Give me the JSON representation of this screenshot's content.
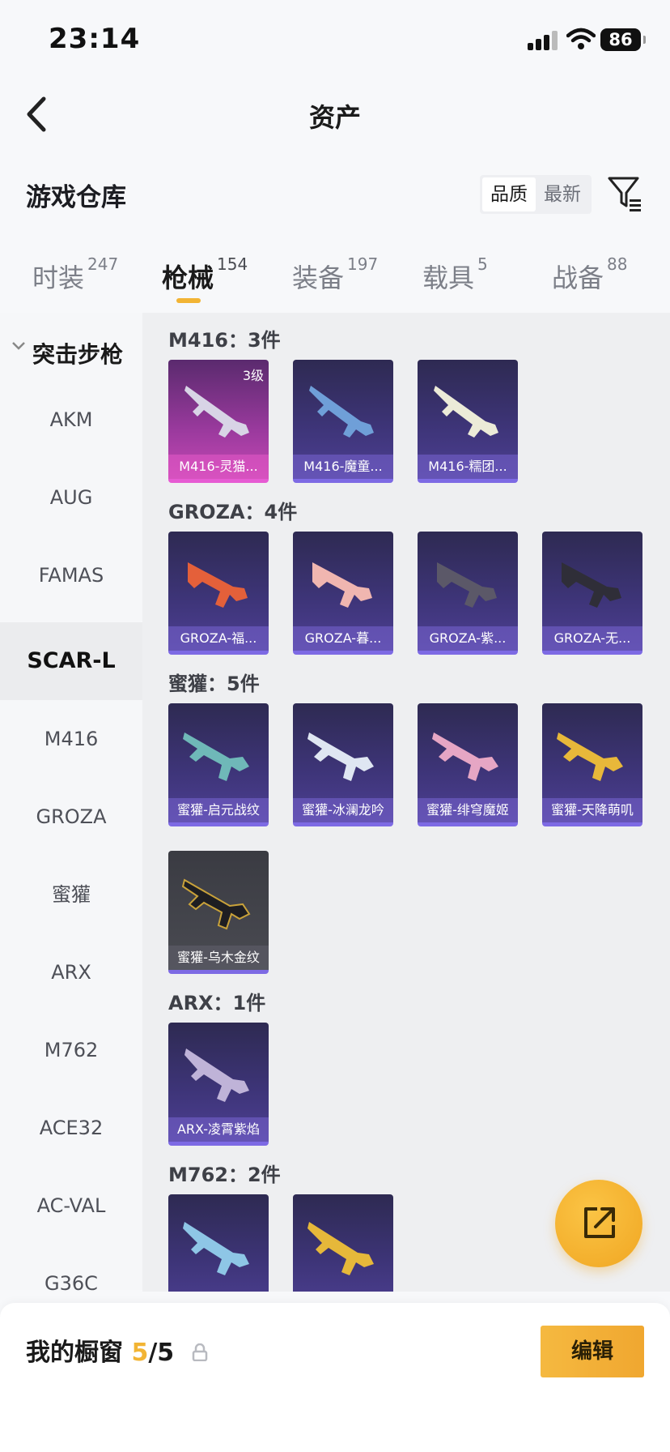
{
  "status_bar": {
    "time": "23:14",
    "battery": "86"
  },
  "nav": {
    "title": "资产"
  },
  "warehouse": {
    "title": "游戏仓库",
    "sort_options": [
      "品质",
      "最新"
    ]
  },
  "tabs": [
    {
      "label": "时装",
      "count": "247"
    },
    {
      "label": "枪械",
      "count": "154"
    },
    {
      "label": "装备",
      "count": "197"
    },
    {
      "label": "载具",
      "count": "5"
    },
    {
      "label": "战备",
      "count": "88"
    }
  ],
  "sidebar": {
    "group": "突击步枪",
    "items": [
      "AKM",
      "AUG",
      "FAMAS",
      "SCAR-L",
      "M416",
      "GROZA",
      "蜜獾",
      "ARX",
      "M762",
      "ACE32",
      "AC-VAL",
      "G36C"
    ],
    "selected": "SCAR-L"
  },
  "sections": [
    {
      "title": "M416：3件",
      "items": [
        {
          "name": "M416-灵猫...",
          "level": "3级"
        },
        {
          "name": "M416-魔童..."
        },
        {
          "name": "M416-糯团..."
        }
      ]
    },
    {
      "title": "GROZA：4件",
      "items": [
        {
          "name": "GROZA-福..."
        },
        {
          "name": "GROZA-暮..."
        },
        {
          "name": "GROZA-紫..."
        },
        {
          "name": "GROZA-无..."
        }
      ]
    },
    {
      "title": "蜜獾：5件",
      "items": [
        {
          "name": "蜜獾-启元战纹"
        },
        {
          "name": "蜜獾-冰澜龙吟"
        },
        {
          "name": "蜜獾-绯穹魔姬"
        },
        {
          "name": "蜜獾-天降萌叽"
        },
        {
          "name": "蜜獾-乌木金纹"
        }
      ]
    },
    {
      "title": "ARX：1件",
      "items": [
        {
          "name": "ARX-凌霄紫焰"
        }
      ]
    },
    {
      "title": "M762：2件",
      "items": [
        {
          "name": ""
        },
        {
          "name": ""
        }
      ]
    }
  ],
  "showcase": {
    "label": "我的橱窗",
    "count": "5",
    "total": "/5",
    "edit_label": "编辑"
  },
  "colors": {
    "accent": "#f2b434",
    "card_purple": "#3d3477",
    "card_pink": "#c548b4"
  },
  "icons": [
    "back-icon",
    "filter-icon",
    "chevron-down-icon",
    "lock-icon",
    "share-icon",
    "signal-icon",
    "wifi-icon",
    "battery-icon"
  ]
}
